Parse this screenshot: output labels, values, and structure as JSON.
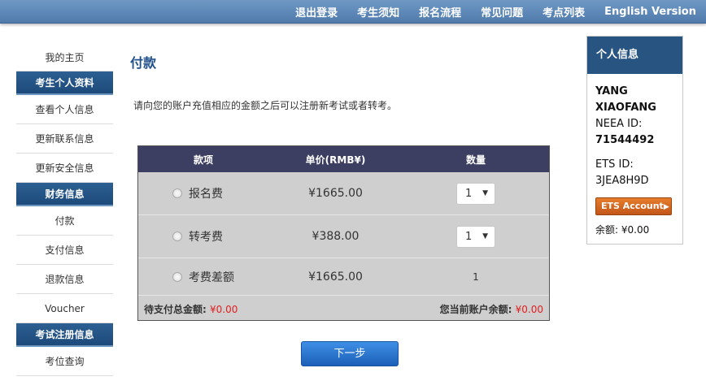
{
  "topnav": [
    "退出登录",
    "考生须知",
    "报名流程",
    "常见问题",
    "考点列表",
    "English Version"
  ],
  "sidebar": {
    "home": "我的主页",
    "sections": [
      {
        "title": "考生个人资料",
        "items": [
          "查看个人信息",
          "更新联系信息",
          "更新安全信息"
        ]
      },
      {
        "title": "财务信息",
        "items": [
          "付款",
          "支付信息",
          "退款信息",
          "Voucher"
        ]
      },
      {
        "title": "考试注册信息",
        "items": [
          "考位查询"
        ]
      }
    ]
  },
  "main": {
    "title": "付款",
    "intro": "请向您的账户充值相应的金额之后可以注册新考试或者转考。",
    "table": {
      "headers": [
        "款项",
        "单价(RMB¥)",
        "数量"
      ],
      "rows": [
        {
          "item": "报名费",
          "price": "¥1665.00",
          "qty": "1",
          "qty_type": "select"
        },
        {
          "item": "转考费",
          "price": "¥388.00",
          "qty": "1",
          "qty_type": "select"
        },
        {
          "item": "考费差额",
          "price": "¥1665.00",
          "qty": "1",
          "qty_type": "text"
        }
      ],
      "total_label": "待支付总金额:",
      "total_value": "¥0.00",
      "balance_label": "您当前账户余额:",
      "balance_value": "¥0.00"
    },
    "next_button": "下一步"
  },
  "info": {
    "title": "个人信息",
    "name_line1": "YANG",
    "name_line2": "XIAOFANG",
    "neea_label": "NEEA ID:",
    "neea_id": "71544492",
    "ets_label": "ETS ID:",
    "ets_id": "3JEA8H9D",
    "ets_button": "ETS Account",
    "balance": "余额: ¥0.00"
  },
  "colors": {
    "accent_red": "#e02020",
    "header_blue": "#285481",
    "table_head": "#3c3f61",
    "ets_orange": "#d96a22"
  }
}
